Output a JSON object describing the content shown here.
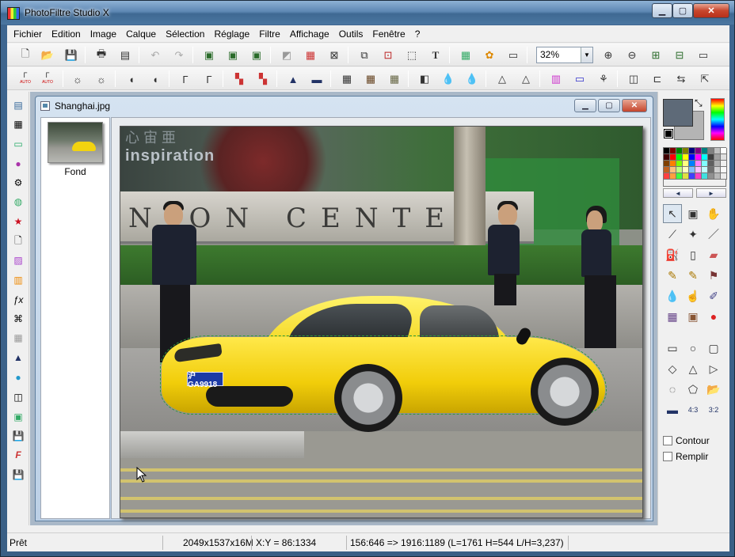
{
  "window": {
    "title": "PhotoFiltre Studio X",
    "minimize_glyph": "▁",
    "maximize_glyph": "▢",
    "close_glyph": "✕"
  },
  "menu": [
    "Fichier",
    "Edition",
    "Image",
    "Calque",
    "Sélection",
    "Réglage",
    "Filtre",
    "Affichage",
    "Outils",
    "Fenêtre",
    "?"
  ],
  "toolbar": {
    "zoom_value": "32%",
    "text_tool_label": "T",
    "auto_labels": [
      "AUTO",
      "AUTO"
    ]
  },
  "document": {
    "title": "Shanghai.jpg",
    "layer_name": "Fond",
    "photo_sign_text": "N  ON CENTER",
    "photo_top_text": "inspiration",
    "plate_text": "沪GA9918"
  },
  "right_panel": {
    "contour_label": "Contour",
    "fill_label": "Remplir",
    "ratio_43": "4:3",
    "ratio_32": "3:2",
    "foreground_color": "#5e6a78",
    "background_color": "#b4b4b4"
  },
  "status": {
    "state": "Prêt",
    "image_info": "2049x1537x16M",
    "coords": "X:Y = 86:1334",
    "selection": "156:646 => 1916:1189 (L=1761  H=544  L/H=3,237)"
  },
  "palette_colors": [
    "#000000",
    "#800000",
    "#008000",
    "#808000",
    "#000080",
    "#800080",
    "#008080",
    "#808080",
    "#c0c0c0",
    "#ffffff",
    "#400000",
    "#ff0000",
    "#00ff00",
    "#ffff00",
    "#0000ff",
    "#ff00ff",
    "#00ffff",
    "#404040",
    "#a0a0a0",
    "#e0e0e0",
    "#804000",
    "#ff8000",
    "#80ff00",
    "#ffff80",
    "#0080ff",
    "#ff80ff",
    "#80ffff",
    "#606060",
    "#b0b0b0",
    "#f0f0f0",
    "#c06020",
    "#ffc080",
    "#c0ff80",
    "#ffffc0",
    "#80c0ff",
    "#ffc0ff",
    "#c0ffff",
    "#707070",
    "#d0d0d0",
    "#fafafa",
    "#ff4040",
    "#ffa040",
    "#40ff40",
    "#e0e040",
    "#4040ff",
    "#ff40c0",
    "#40e0e0",
    "#909090",
    "#b8b8b8",
    "#ececec"
  ]
}
